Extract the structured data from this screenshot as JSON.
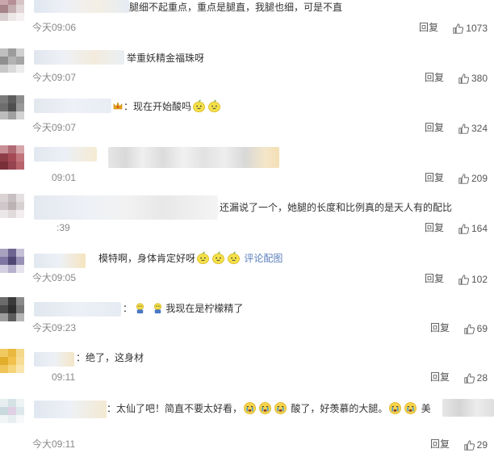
{
  "comments": [
    {
      "text": "腿细不起重点，重点是腿直，我腿也细，可是不直",
      "time": "今天09:06",
      "reply": "回复",
      "likes": "1073"
    },
    {
      "text": "举重妖精金福珠呀",
      "time": "今大09:07",
      "reply": "回复",
      "likes": "380"
    },
    {
      "text": "：现在开始酸吗",
      "time": "今天09:07",
      "reply": "回复",
      "likes": "324"
    },
    {
      "text": "",
      "time": "09:01",
      "reply": "回复",
      "likes": "209"
    },
    {
      "text": "还漏说了一个，她腿的长度和比例真的是天人有的配比",
      "time": ":39",
      "reply": "回复",
      "likes": "164"
    },
    {
      "text": "模特啊，身体肯定好呀",
      "link": "评论配图",
      "time": "今大09:05",
      "reply": "回复",
      "likes": "102"
    },
    {
      "text": "我现在是柠檬精了",
      "prefix": "：",
      "time": "今天09:23",
      "reply": "回复",
      "likes": "69"
    },
    {
      "text": "：绝了，这身材",
      "time": "09:11",
      "reply": "回复",
      "likes": "28"
    },
    {
      "text1": "：太仙了吧！简直不要太好看，",
      "text2": "酸了，好羡慕的大腿。",
      "text3": "美",
      "time": "今大09:11",
      "reply": "回复",
      "likes": "29"
    }
  ],
  "colors": {
    "link": "#5b7fbd",
    "time": "#888888",
    "text": "#333333"
  },
  "icons": {
    "like": "thumbs-up-icon",
    "emoji_lemon": "lemon-face-emoji",
    "emoji_cry": "crying-face-emoji",
    "emoji_crown": "crown-emoji"
  }
}
